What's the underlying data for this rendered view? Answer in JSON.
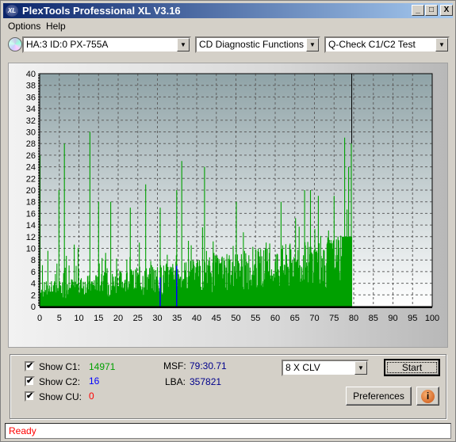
{
  "window": {
    "title": "PlexTools Professional XL V3.16",
    "logo": "XL",
    "minimize": "_",
    "maximize": "□",
    "close": "X"
  },
  "menu": {
    "items": [
      "Options",
      "Help"
    ]
  },
  "toolbar": {
    "drive": "HA:3 ID:0  PX-755A",
    "category": "CD Diagnostic Functions",
    "test": "Q-Check C1/C2 Test"
  },
  "chart_data": {
    "type": "bar",
    "x_ticks": [
      "0",
      "5",
      "10",
      "15",
      "20",
      "25",
      "30",
      "35",
      "40",
      "45",
      "50",
      "55",
      "60",
      "65",
      "70",
      "75",
      "80",
      "85",
      "90",
      "95",
      "100"
    ],
    "y_ticks": [
      "0",
      "2",
      "4",
      "6",
      "8",
      "10",
      "12",
      "14",
      "16",
      "18",
      "20",
      "22",
      "24",
      "26",
      "28",
      "30",
      "32",
      "34",
      "36",
      "38",
      "40"
    ],
    "xlim": [
      0,
      100
    ],
    "ylim": [
      0,
      40
    ],
    "grid": true,
    "background_gradient": [
      "#8fa3a7",
      "#ffffff"
    ],
    "series": [
      {
        "name": "C1",
        "color": "#00a000",
        "peaks": [
          [
            0.1,
            26
          ],
          [
            4.9,
            20
          ],
          [
            6.3,
            28
          ],
          [
            12.8,
            30
          ],
          [
            15,
            18
          ],
          [
            18.1,
            18
          ],
          [
            23.1,
            17
          ],
          [
            27,
            21
          ],
          [
            30.7,
            17
          ],
          [
            34.9,
            20
          ],
          [
            36.2,
            25
          ],
          [
            42,
            24
          ],
          [
            50.1,
            18
          ],
          [
            61.5,
            18
          ],
          [
            67.5,
            20
          ],
          [
            69,
            20
          ],
          [
            71,
            19
          ],
          [
            75,
            19
          ],
          [
            77.7,
            29
          ],
          [
            78.7,
            24
          ],
          [
            79.4,
            28
          ]
        ]
      },
      {
        "name": "C2",
        "color": "#0000ff",
        "points": [
          [
            30.7,
            5
          ],
          [
            34.9,
            7
          ]
        ]
      }
    ],
    "end_marker": 79.5
  },
  "stats": {
    "c1_label": "Show C1:",
    "c1_value": "14971",
    "c2_label": "Show C2:",
    "c2_value": "16",
    "cu_label": "Show CU:",
    "cu_value": "0",
    "msf_label": "MSF:",
    "msf_value": "79:30.71",
    "lba_label": "LBA:",
    "lba_value": "357821",
    "check": "✔"
  },
  "controls": {
    "speed": "8 X CLV",
    "start": "Start",
    "preferences": "Preferences",
    "info": "i"
  },
  "status": "Ready"
}
